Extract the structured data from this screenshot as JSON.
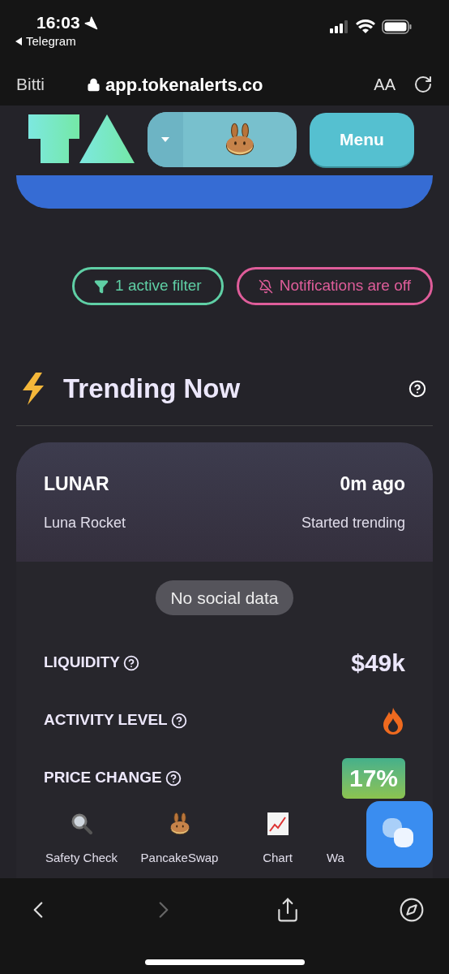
{
  "status_bar": {
    "time": "16:03",
    "back_app": "Telegram"
  },
  "browser": {
    "left_label": "Bitti",
    "url": "app.tokenalerts.co",
    "text_size": "AA"
  },
  "header": {
    "menu_button": "Menu"
  },
  "filters": [
    {
      "kind": "filter",
      "label": "1 active filter"
    },
    {
      "kind": "notifications",
      "label": "Notifications are off"
    }
  ],
  "section": {
    "title": "Trending Now"
  },
  "card": {
    "symbol": "LUNAR",
    "time": "0m ago",
    "name": "Luna Rocket",
    "event": "Started trending",
    "social": "No social data",
    "stats": [
      {
        "kind": "value",
        "label": "LIQUIDITY",
        "value": "$49k"
      },
      {
        "kind": "flame",
        "label": "ACTIVITY LEVEL"
      },
      {
        "kind": "badge",
        "label": "PRICE CHANGE",
        "value": "17%"
      }
    ],
    "actions": [
      {
        "kind": "search",
        "label": "Safety Check"
      },
      {
        "kind": "pancake",
        "label": "PancakeSwap"
      },
      {
        "kind": "chart",
        "label": "Chart"
      },
      {
        "kind": "other",
        "label": "Wa"
      }
    ]
  }
}
